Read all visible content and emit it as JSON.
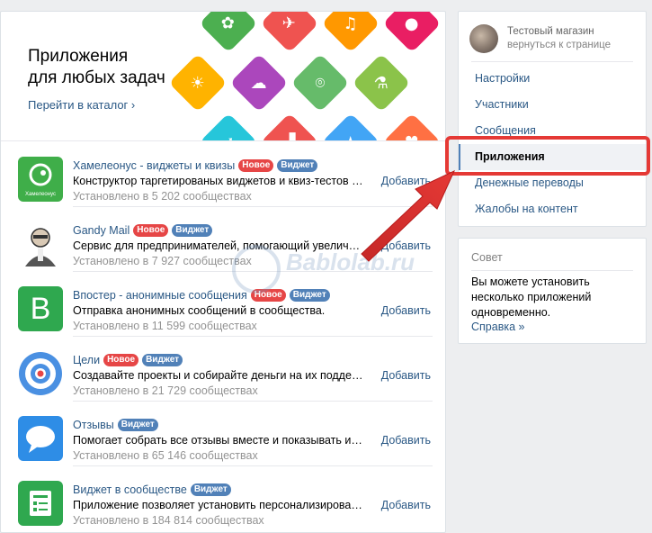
{
  "banner": {
    "title_line1": "Приложения",
    "title_line2": "для любых задач",
    "catalog_link": "Перейти в каталог ›"
  },
  "apps": [
    {
      "name": "Хамелеонус - виджеты и квизы",
      "badges": [
        "Новое",
        "Виджет"
      ],
      "description": "Конструктор таргетированых виджетов и квиз-тестов дл...",
      "installs": "Установлено в 5 202 сообществах",
      "add": "Добавить",
      "icon_label": "Хамелеонус",
      "icon_color": "#3fae49"
    },
    {
      "name": "Gandy Mail",
      "badges": [
        "Новое",
        "Виджет"
      ],
      "description": "Сервис для предпринимателей, помогающий увеличить ...",
      "installs": "Установлено в 7 927 сообществах",
      "add": "Добавить",
      "icon_color": "#ffffff"
    },
    {
      "name": "Впостер - анонимные сообщения",
      "badges": [
        "Новое",
        "Виджет"
      ],
      "description": "Отправка анонимных сообщений в сообщества.",
      "installs": "Установлено в 11 599 сообществах",
      "add": "Добавить",
      "icon_label": "B",
      "icon_color": "#2fa84f"
    },
    {
      "name": "Цели",
      "badges": [
        "Новое",
        "Виджет"
      ],
      "description": "Создавайте проекты и собирайте деньги на их поддержку.",
      "installs": "Установлено в 21 729 сообществах",
      "add": "Добавить",
      "icon_color": "#4a90e2"
    },
    {
      "name": "Отзывы",
      "badges": [
        "Виджет"
      ],
      "description": "Помогает собрать все отзывы вместе и показывать их в...",
      "installs": "Установлено в 65 146 сообществах",
      "add": "Добавить",
      "icon_color": "#2e8de6"
    },
    {
      "name": "Виджет в сообществе",
      "badges": [
        "Виджет"
      ],
      "description": "Приложение позволяет установить персонализированн...",
      "installs": "Установлено в 184 814 сообществах",
      "add": "Добавить",
      "icon_color": "#2fa84f"
    }
  ],
  "sidebar": {
    "group_name": "Тестовый магазин",
    "back_link": "вернуться к странице",
    "menu": [
      {
        "label": "Настройки",
        "active": false
      },
      {
        "label": "Участники",
        "active": false
      },
      {
        "label": "Сообщения",
        "active": false
      },
      {
        "label": "Приложения",
        "active": true
      },
      {
        "label": "Денежные переводы",
        "active": false
      },
      {
        "label": "Жалобы на контент",
        "active": false
      }
    ]
  },
  "tip": {
    "title": "Совет",
    "text": "Вы можете установить несколько приложений одновременно.",
    "link": "Справка »"
  },
  "watermark": "Bablolab.ru",
  "colors": {
    "link": "#2a5885",
    "badge_new": "#e64646",
    "badge_widget": "#5181b8",
    "highlight": "#e53935"
  },
  "banner_tiles": [
    {
      "icon": "flower-icon",
      "color": "#4caf50"
    },
    {
      "icon": "airplane-icon",
      "color": "#ef5350"
    },
    {
      "icon": "bell-icon",
      "color": "#ff9800"
    },
    {
      "icon": "apple-icon",
      "color": "#e91e63"
    },
    {
      "icon": "sun-icon",
      "color": "#ffb300"
    },
    {
      "icon": "cloud-icon",
      "color": "#ab47bc"
    },
    {
      "icon": "map-pin-icon",
      "color": "#66bb6a"
    },
    {
      "icon": "flask-icon",
      "color": "#8bc34a"
    },
    {
      "icon": "rocket-icon",
      "color": "#26c6da"
    },
    {
      "icon": "boot-icon",
      "color": "#ef5350"
    },
    {
      "icon": "star-icon",
      "color": "#42a5f5"
    },
    {
      "icon": "heart-icon",
      "color": "#ff7043"
    }
  ]
}
